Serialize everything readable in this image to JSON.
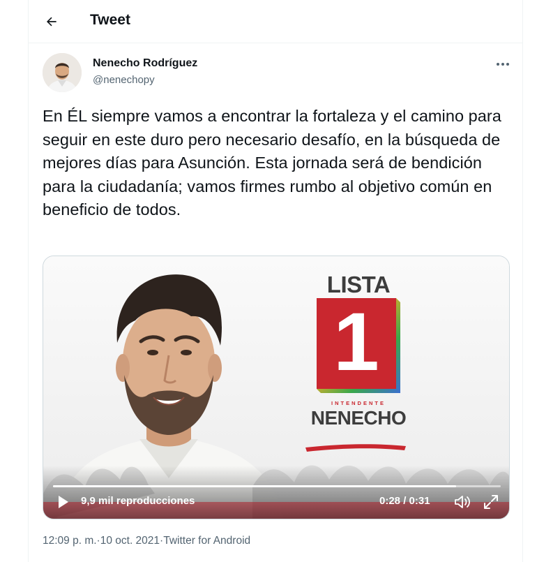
{
  "header": {
    "title": "Tweet"
  },
  "author": {
    "name": "Nenecho Rodríguez",
    "handle": "@nenechopy"
  },
  "tweet": {
    "text": "En ÉL siempre vamos a encontrar la fortaleza y el camino para seguir en este duro pero necesario desafío, en la búsqueda de mejores días para Asunción. Esta jornada será de bendición para la ciudadanía; vamos firmes rumbo al objetivo común en beneficio de todos."
  },
  "media": {
    "brand_lista": "LISTA",
    "brand_number": "1",
    "brand_role": "INTENDENTE",
    "brand_name": "NENECHO",
    "views": "9,9 mil reproducciones",
    "time": "0:28 / 0:31",
    "progress_fraction": 0.9
  },
  "meta": {
    "time": "12:09 p. m.",
    "separator": " · ",
    "date": "10 oct. 2021",
    "source": "Twitter for Android"
  },
  "icons": {
    "back": "back-arrow-icon",
    "more": "more-icon",
    "play": "play-icon",
    "volume": "volume-icon",
    "fullscreen": "fullscreen-icon"
  },
  "colors": {
    "text_primary": "#0f1419",
    "text_secondary": "#536471",
    "border": "#cfd9de",
    "brand_red": "#c9272f"
  }
}
